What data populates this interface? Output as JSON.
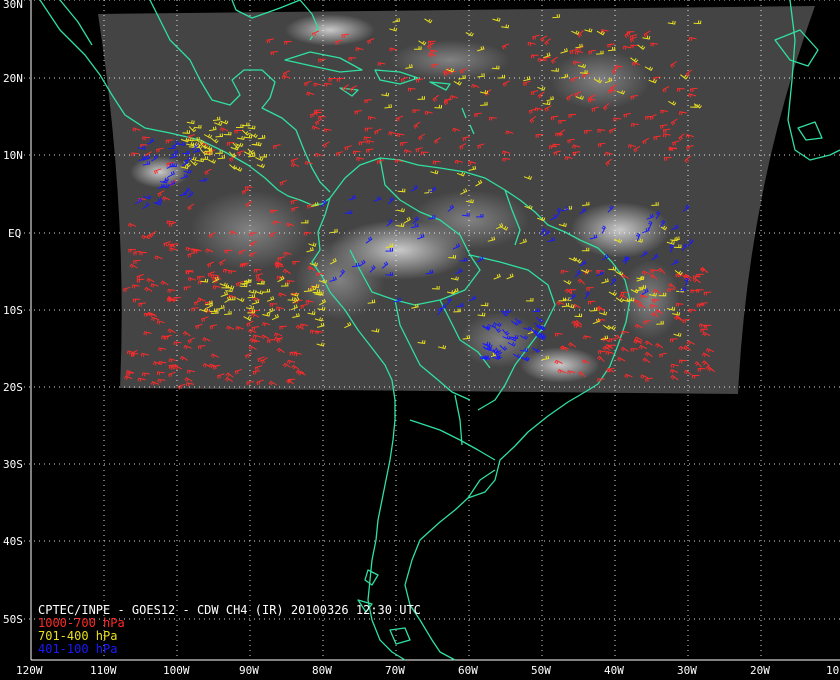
{
  "title": "CPTEC/INPE - GOES12 - CDW CH4 (IR) 20100326 12:30 UTC",
  "legend": [
    {
      "label": "1000-700 hPa",
      "color": "#ff2a2a"
    },
    {
      "label": "701-400 hPa",
      "color": "#e8e020"
    },
    {
      "label": "401-100 hPa",
      "color": "#1a1aff"
    }
  ],
  "lat_labels": [
    "30N",
    "20N",
    "10N",
    "EQ",
    "10S",
    "20S",
    "30S",
    "40S",
    "50S"
  ],
  "lon_labels": [
    "120W",
    "110W",
    "100W",
    "90W",
    "80W",
    "70W",
    "60W",
    "50W",
    "40W",
    "30W",
    "20W",
    "10"
  ],
  "colors": {
    "background": "#000000",
    "coast": "#30e0a0",
    "grid": "#ffffff",
    "satellite": "#444444"
  }
}
